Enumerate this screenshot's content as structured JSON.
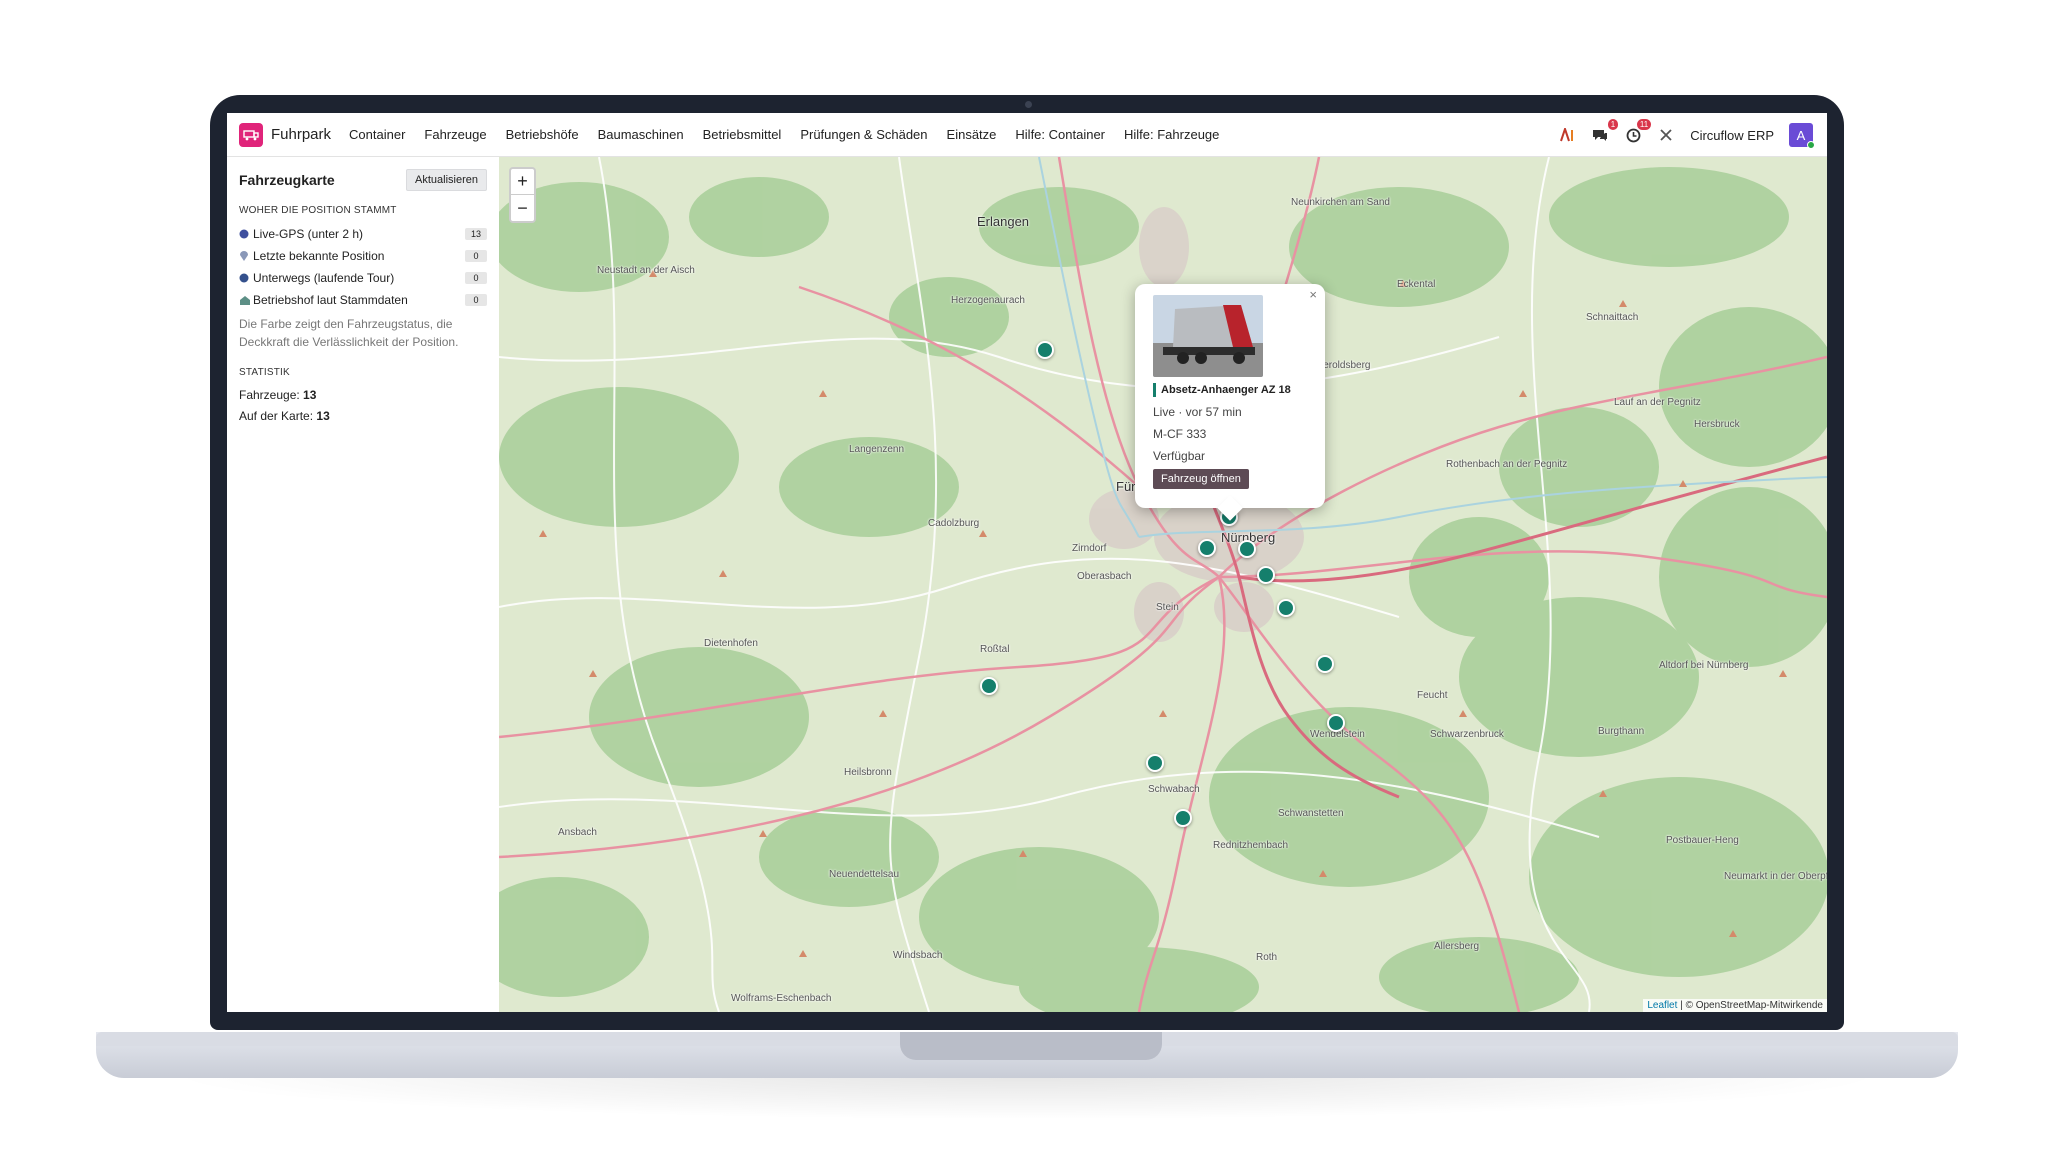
{
  "nav": {
    "brand": "Fuhrpark",
    "menu": [
      "Container",
      "Fahrzeuge",
      "Betriebshöfe",
      "Baumaschinen",
      "Betriebsmittel",
      "Prüfungen & Schäden",
      "Einsätze",
      "Hilfe: Container",
      "Hilfe: Fahrzeuge"
    ],
    "chat_badge": "1",
    "activity_badge": "11",
    "company": "Circuflow ERP",
    "avatar_letter": "A"
  },
  "sidebar": {
    "title": "Fahrzeugkarte",
    "refresh_label": "Aktualisieren",
    "position_section": "WOHER DIE POSITION STAMMT",
    "legend": [
      {
        "label": "Live-GPS (unter 2 h)",
        "count": "13",
        "marker": "dot",
        "color": "#3f4f9e"
      },
      {
        "label": "Letzte bekannte Position",
        "count": "0",
        "marker": "pin",
        "color": "#8a98b8"
      },
      {
        "label": "Unterwegs (laufende Tour)",
        "count": "0",
        "marker": "dot",
        "color": "#34508c"
      },
      {
        "label": "Betriebshof laut Stammdaten",
        "count": "0",
        "marker": "depot",
        "color": "#5d8f86"
      }
    ],
    "note": "Die Farbe zeigt den Fahrzeugstatus, die Deckkraft die Verlässlichkeit der Position.",
    "stats_section": "STATISTIK",
    "stats": {
      "vehicles_label": "Fahrzeuge:",
      "vehicles_value": "13",
      "on_map_label": "Auf der Karte:",
      "on_map_value": "13"
    }
  },
  "map": {
    "zoom_in": "+",
    "zoom_out": "−",
    "attribution_link": "Leaflet",
    "attribution_text": "| © OpenStreetMap-Mitwirkende",
    "places": [
      "Erlangen",
      "Neunkirchen am Sand",
      "Neustadt an der Aisch",
      "Herzogenaurach",
      "Eckental",
      "Schnaittach",
      "Heroldsberg",
      "Lauf an der Pegnitz",
      "Hersbruck",
      "Langenzenn",
      "Rothenbach an der Pegnitz",
      "Cadolzburg",
      "Zirndorf",
      "Oberasbach",
      "Fürth",
      "Nürnberg",
      "Stein",
      "Dietenhofen",
      "Roßtal",
      "Feucht",
      "Altdorf bei Nürnberg",
      "Wendelstein",
      "Schwarzenbruck",
      "Burgthann",
      "Heilsbronn",
      "Schwabach",
      "Schwanstetten",
      "Ansbach",
      "Rednitzhembach",
      "Neuendettelsau",
      "Postbauer-Heng",
      "Neumarkt in der Oberpfalz",
      "Allersberg",
      "Windsbach",
      "Roth",
      "Wolframs-Eschenbach"
    ],
    "vehicle_count": 13
  },
  "popup": {
    "close": "×",
    "title": "Absetz-Anhaenger AZ 18",
    "status_line": "Live · vor 57 min",
    "plate": "M-CF 333",
    "availability": "Verfügbar",
    "button": "Fahrzeug öffnen",
    "accent": "#157f6c"
  }
}
